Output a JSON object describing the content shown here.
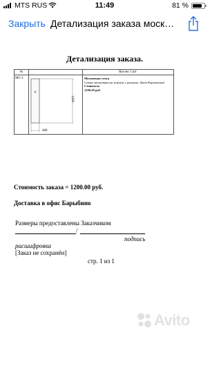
{
  "status_bar": {
    "carrier": "MTS RUS",
    "time": "11:49",
    "battery_percent": "81 %",
    "battery_level": 0.81
  },
  "nav_bar": {
    "close_label": "Закрыть",
    "title": "Детализация заказа моск…",
    "share_icon": "share-icon",
    "accent_color": "#1f6fe0"
  },
  "document": {
    "title": "Детализация заказа.",
    "table": {
      "header_number": "№",
      "header_quantity": "Кол-во 1 шт",
      "item_code": "МС-1",
      "item_name": "Москитная сетка",
      "item_note": "Сетка москитная на зацепах с ручками. Цвет Коричневый",
      "cost_label": "Стоимость",
      "cost_value": "1200.00 руб.",
      "dim_height": "1200",
      "dim_width": "400"
    },
    "order_total": "Стоимость заказа = 1200.00 руб.",
    "delivery": "Доставка в офис Барыбино",
    "sizes_note": "Размеры предоставлены Заказчиком",
    "signature_slash": "/",
    "signature_label": "подпись",
    "decode_label": "расшифровка",
    "not_saved": "[Заказ не сохранён]",
    "page_number": "стр. 1 из 1"
  },
  "watermark": {
    "text": "Avito"
  }
}
